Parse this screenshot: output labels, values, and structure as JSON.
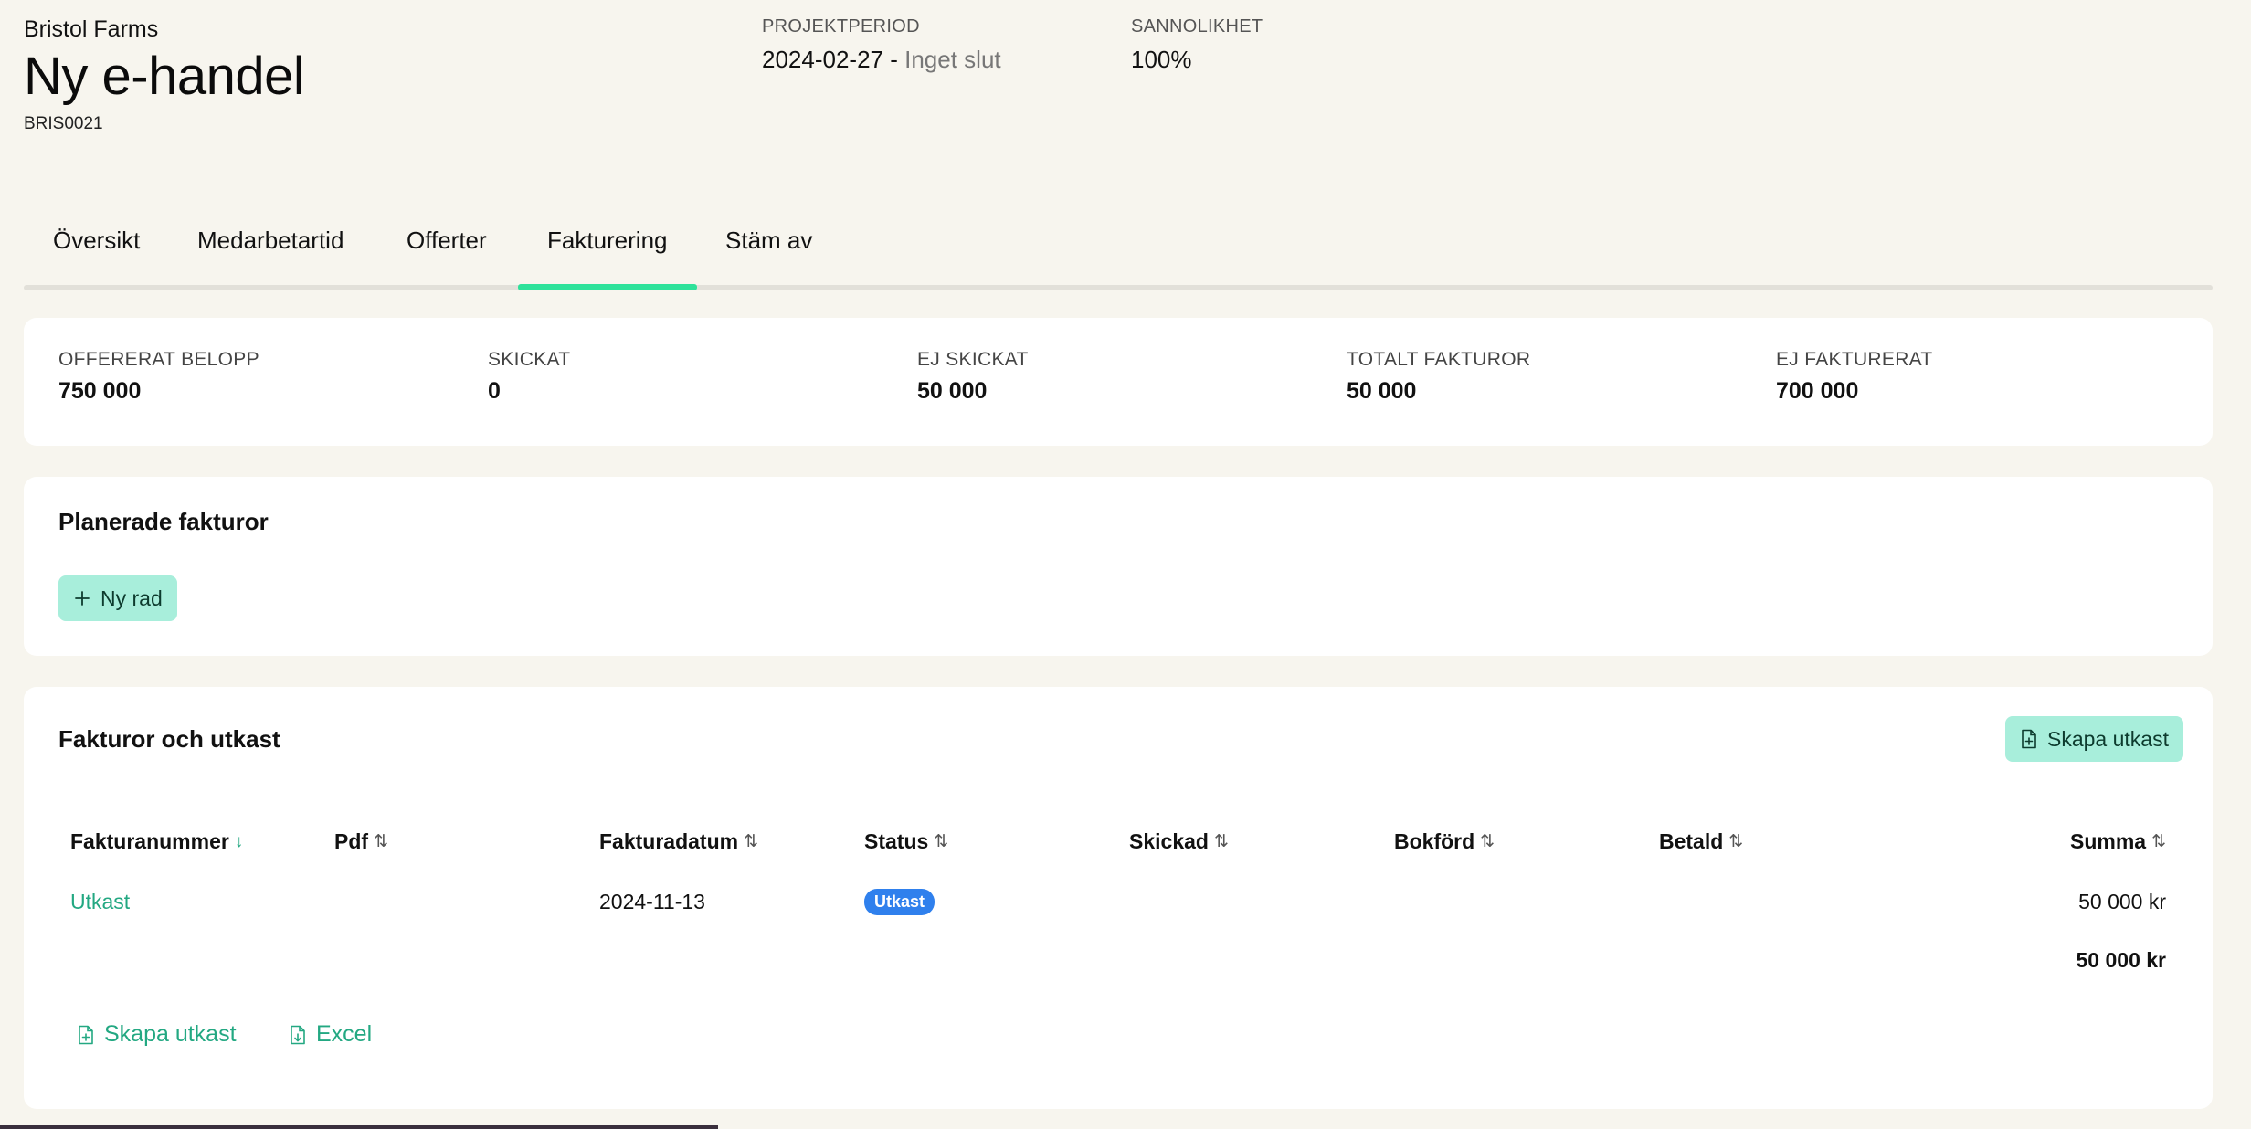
{
  "header": {
    "client": "Bristol Farms",
    "title": "Ny e-handel",
    "code": "BRIS0021",
    "period_label": "PROJEKTPERIOD",
    "period_start": "2024-02-27 -",
    "period_end": "Inget slut",
    "probability_label": "SANNOLIKHET",
    "probability_value": "100%"
  },
  "tabs": [
    {
      "label": "Översikt"
    },
    {
      "label": "Medarbetartid"
    },
    {
      "label": "Offerter"
    },
    {
      "label": "Fakturering"
    },
    {
      "label": "Stäm av"
    }
  ],
  "active_tab": "Fakturering",
  "colors": {
    "accent": "#2ee29a",
    "link": "#23a882",
    "mint": "#a8eedb",
    "badge": "#2f80ed"
  },
  "stats": [
    {
      "label": "OFFERERAT BELOPP",
      "value": "750 000"
    },
    {
      "label": "SKICKAT",
      "value": "0"
    },
    {
      "label": "EJ SKICKAT",
      "value": "50 000"
    },
    {
      "label": "TOTALT FAKTUROR",
      "value": "50 000"
    },
    {
      "label": "EJ FAKTURERAT",
      "value": "700 000"
    }
  ],
  "planned": {
    "title": "Planerade fakturor",
    "new_row_label": "Ny rad"
  },
  "invoices": {
    "title": "Fakturor och utkast",
    "create_draft_label": "Skapa utkast",
    "columns": [
      {
        "label": "Fakturanummer",
        "sort": "↓"
      },
      {
        "label": "Pdf",
        "sort": "⇅"
      },
      {
        "label": "Fakturadatum",
        "sort": "⇅"
      },
      {
        "label": "Status",
        "sort": "⇅"
      },
      {
        "label": "Skickad",
        "sort": "⇅"
      },
      {
        "label": "Bokförd",
        "sort": "⇅"
      },
      {
        "label": "Betald",
        "sort": "⇅"
      },
      {
        "label": "Summa",
        "sort": "⇅"
      }
    ],
    "rows": [
      {
        "number": "Utkast",
        "pdf": "",
        "date": "2024-11-13",
        "status": "Utkast",
        "sent": "",
        "booked": "",
        "paid": "",
        "sum": "50 000 kr"
      }
    ],
    "total": "50 000 kr",
    "footer_create_label": "Skapa utkast",
    "footer_excel_label": "Excel"
  }
}
